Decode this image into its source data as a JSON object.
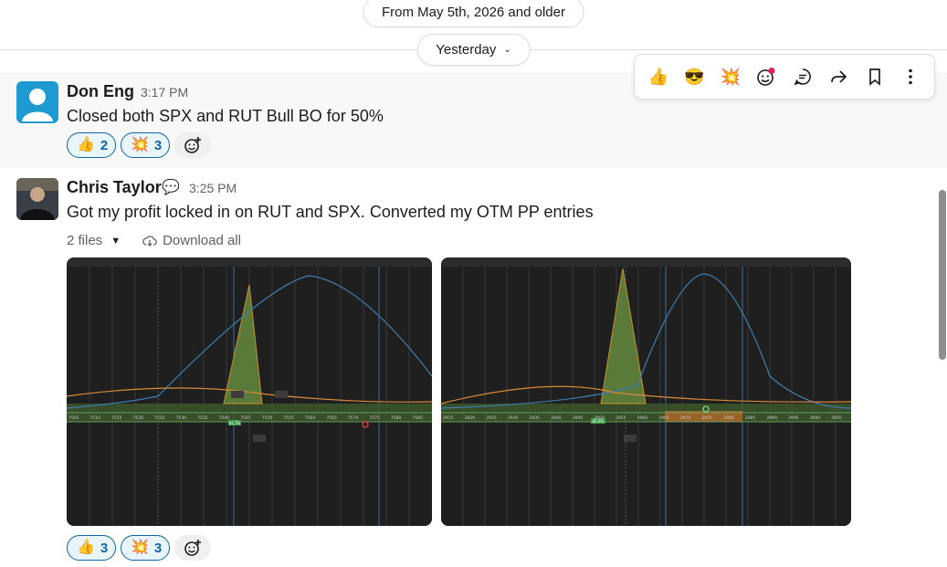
{
  "date_pills": {
    "older": "From May 5th, 2026 and older",
    "yesterday": "Yesterday"
  },
  "toolbar": {
    "items": [
      "thumbs-up-icon",
      "sunglasses-face-icon",
      "collision-icon",
      "add-reaction-icon",
      "reply-thread-icon",
      "forward-icon",
      "bookmark-icon",
      "more-actions-icon"
    ]
  },
  "messages": [
    {
      "sender": "Don Eng",
      "time": "3:17 PM",
      "text": "Closed both SPX and RUT Bull BO for 50%",
      "reactions": [
        {
          "emoji": "👍",
          "count": "2"
        },
        {
          "emoji": "💥",
          "count": "3"
        }
      ]
    },
    {
      "sender": "Chris Taylor",
      "time": "3:25 PM",
      "text": "Got my profit locked in on RUT and SPX. Converted my OTM PP entries",
      "files_label": "2 files",
      "download_label": "Download all",
      "reactions": [
        {
          "emoji": "👍",
          "count": "3"
        },
        {
          "emoji": "💥",
          "count": "3"
        }
      ],
      "attachments": [
        {
          "axis": [
            "7505",
            "7510",
            "7515",
            "7520",
            "7525",
            "7530",
            "7535",
            "7540",
            "7545",
            "7550",
            "7555",
            "7560",
            "7565",
            "7570",
            "7575",
            "7580",
            "7585"
          ],
          "badge": "81.7%"
        },
        {
          "axis": [
            "2915",
            "2920",
            "2925",
            "2930",
            "2935",
            "2940",
            "2945",
            "2950",
            "2955",
            "2960",
            "2965",
            "2970",
            "2975",
            "2980",
            "2985",
            "2990",
            "2995",
            "3000",
            "3005"
          ],
          "badge": "80.9%"
        }
      ]
    }
  ],
  "colors": {
    "accent": "#1264a3",
    "reaction_bg": "#e8f5fa",
    "chart_bg": "#1f1f1f",
    "curve_blue": "#3d7fb0",
    "curve_orange": "#d98a3a",
    "profit_green": "#5a7a3a"
  }
}
